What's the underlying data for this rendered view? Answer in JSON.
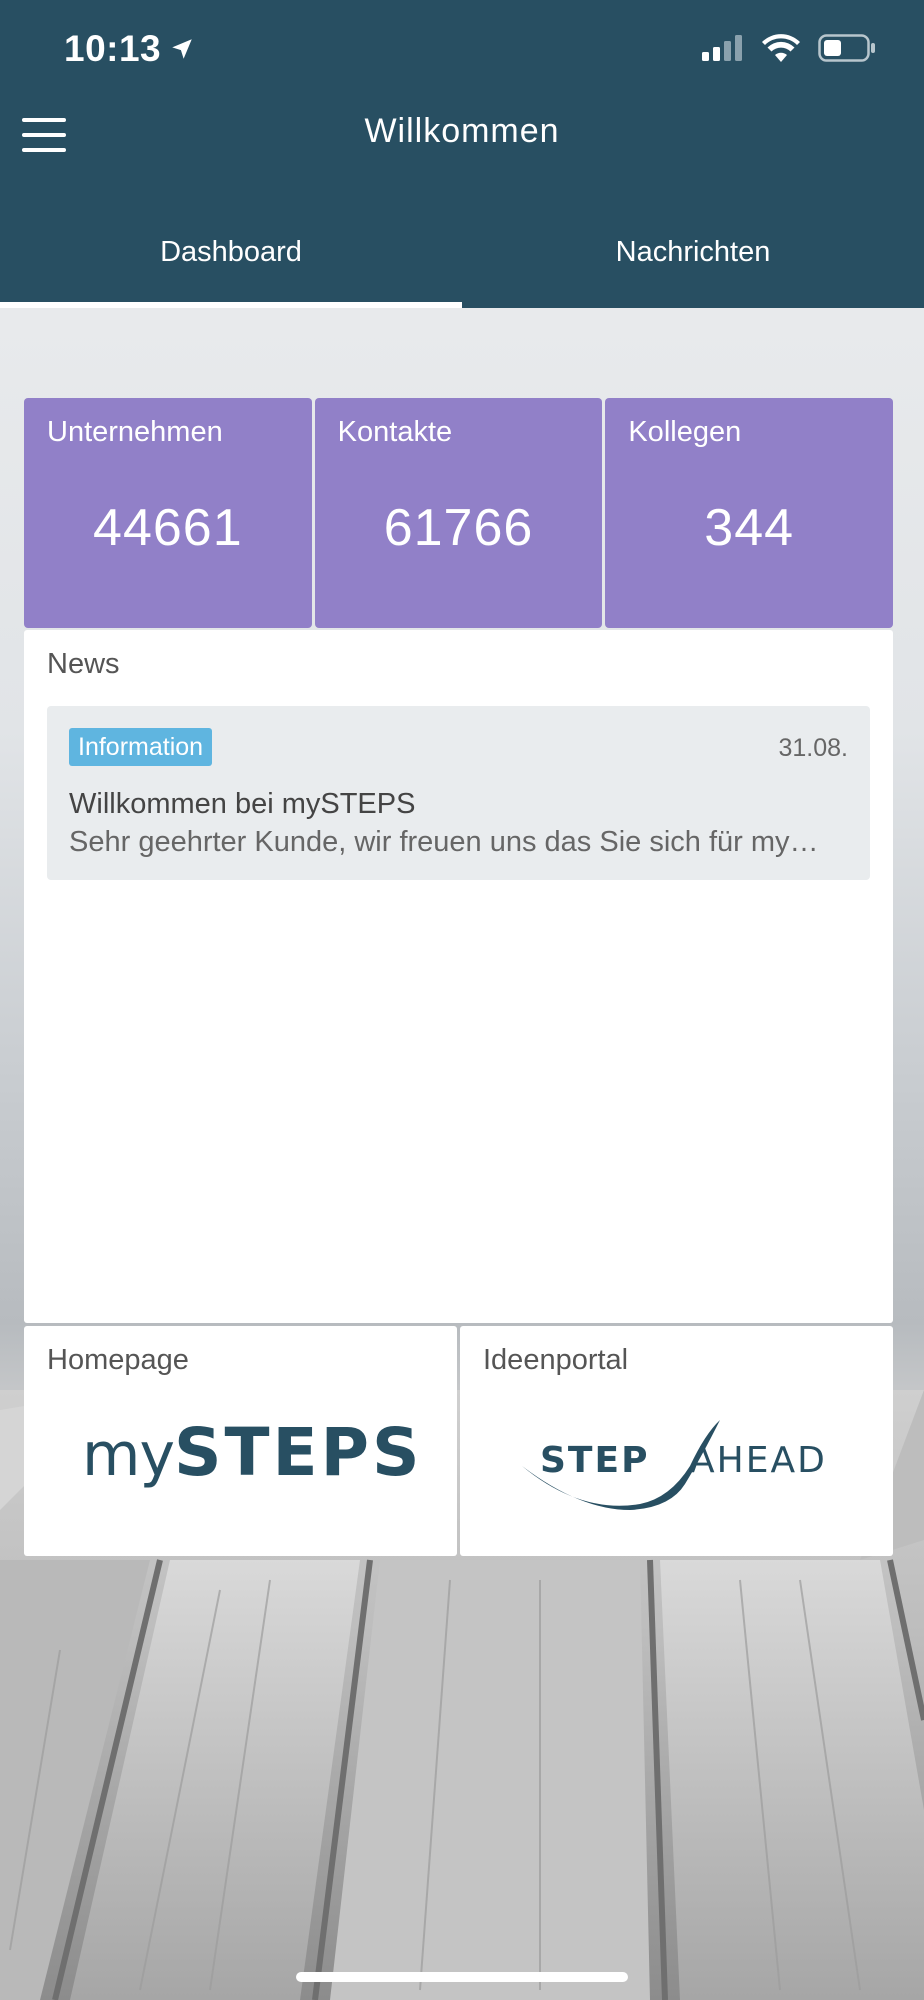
{
  "status_bar": {
    "time": "10:13",
    "icons": [
      "location-arrow-icon",
      "cellular-signal-icon",
      "wifi-icon",
      "battery-icon"
    ]
  },
  "header": {
    "title": "Willkommen",
    "menu_icon": "hamburger-menu-icon",
    "background_color": "#284f62"
  },
  "tabs": [
    {
      "label": "Dashboard",
      "active": true
    },
    {
      "label": "Nachrichten",
      "active": false
    }
  ],
  "stats": [
    {
      "label": "Unternehmen",
      "value": "44661"
    },
    {
      "label": "Kontakte",
      "value": "61766"
    },
    {
      "label": "Kollegen",
      "value": "344"
    }
  ],
  "stats_color": "#9180c8",
  "news": {
    "title": "News",
    "items": [
      {
        "badge": "Information",
        "date": "31.08.",
        "headline": "Willkommen bei mySTEPS",
        "snippet": "Sehr geehrter Kunde, wir freuen uns das Sie sich für my…"
      }
    ],
    "badge_color": "#5fb5e0"
  },
  "links": [
    {
      "label": "Homepage",
      "logo_text_1": "my",
      "logo_text_2": "STEPS"
    },
    {
      "label": "Ideenportal",
      "logo_text_1": "STEP",
      "logo_text_2": "AHEAD"
    }
  ]
}
